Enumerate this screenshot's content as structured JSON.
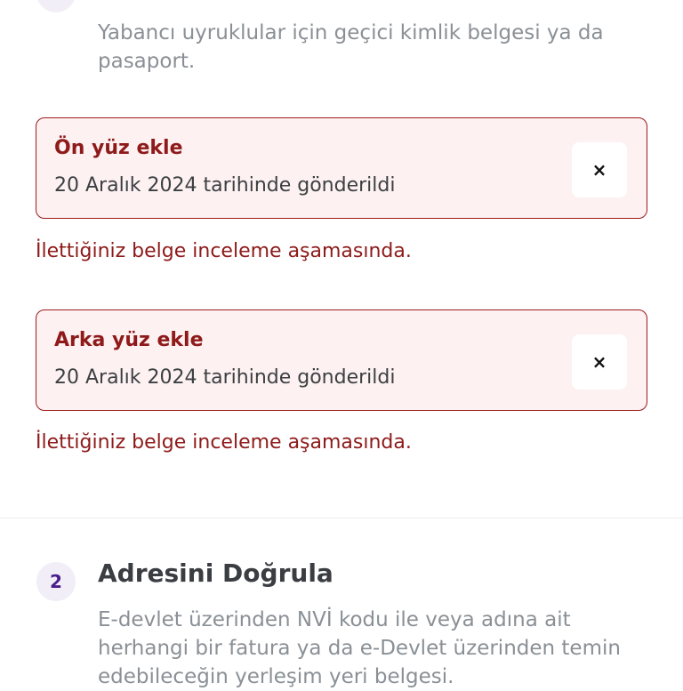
{
  "section1": {
    "description": "Yabancı uyruklular için geçici kimlik belgesi ya da pasaport."
  },
  "documents": [
    {
      "title": "Ön yüz ekle",
      "submitted": "20 Aralık 2024 tarihinde gönderildi",
      "close_symbol": "×",
      "status_message": "İlettiğiniz belge inceleme aşamasında."
    },
    {
      "title": "Arka yüz ekle",
      "submitted": "20 Aralık 2024 tarihinde gönderildi",
      "close_symbol": "×",
      "status_message": "İlettiğiniz belge inceleme aşamasında."
    }
  ],
  "section2": {
    "step_number": "2",
    "title": "Adresini Doğrula",
    "description": "E-devlet üzerinden NVİ kodu ile veya adına ait herhangi bir fatura ya da e-Devlet üzerinden temin edebileceğin yerleşim yeri belgesi."
  },
  "colors": {
    "error_red": "#8e1a1a",
    "card_background": "#fdf1f2",
    "step_circle": "#f1eef8",
    "step_number": "#4a1d8c",
    "muted_text": "#8a9096"
  }
}
